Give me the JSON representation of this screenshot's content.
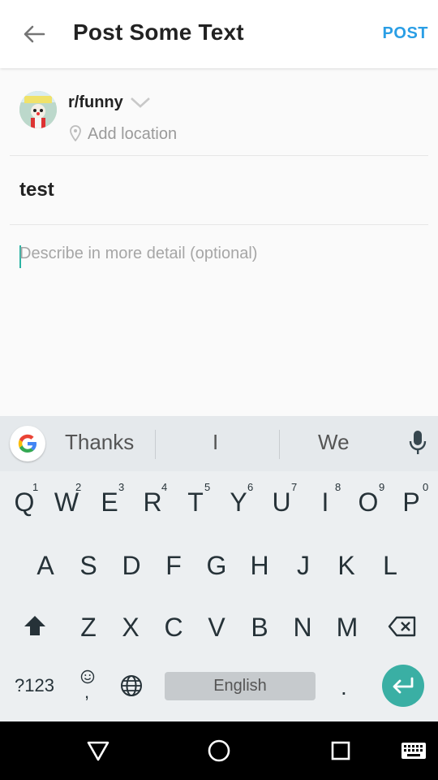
{
  "header": {
    "title": "Post Some Text",
    "post_label": "POST"
  },
  "community": {
    "name": "r/funny",
    "location_placeholder": "Add location"
  },
  "post": {
    "title": "test",
    "body_placeholder": "Describe in more detail (optional)"
  },
  "keyboard": {
    "suggestions": [
      "Thanks",
      "I",
      "We"
    ],
    "row1": [
      "Q",
      "W",
      "E",
      "R",
      "T",
      "Y",
      "U",
      "I",
      "O",
      "P"
    ],
    "row1_hints": [
      "1",
      "2",
      "3",
      "4",
      "5",
      "6",
      "7",
      "8",
      "9",
      "0"
    ],
    "row2": [
      "A",
      "S",
      "D",
      "F",
      "G",
      "H",
      "J",
      "K",
      "L"
    ],
    "row3": [
      "Z",
      "X",
      "C",
      "V",
      "B",
      "N",
      "M"
    ],
    "symbols_label": "?123",
    "space_label": "English",
    "period_label": "."
  },
  "colors": {
    "accent": "#2a9ee5",
    "enter": "#3aafa4"
  }
}
